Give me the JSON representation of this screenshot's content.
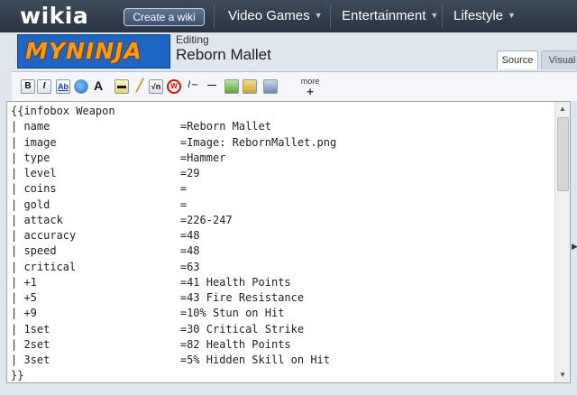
{
  "topnav": {
    "logo": "wikia",
    "create_wiki": "Create a wiki",
    "items": [
      "Video Games",
      "Entertainment",
      "Lifestyle"
    ]
  },
  "header": {
    "wordmark": "MYNINJA",
    "editing_label": "Editing",
    "page_title": "Reborn Mallet",
    "tabs": {
      "source": "Source",
      "visual": "Visual"
    }
  },
  "toolbar": {
    "buttons": [
      "B",
      "I",
      "Ab",
      "link-globe",
      "A",
      "image",
      "brush",
      "sqrt",
      "no-wiki",
      "signature",
      "hr",
      "gallery",
      "table",
      "template"
    ],
    "more_label": "more",
    "more_plus": "+"
  },
  "editor": {
    "content": "{{infobox Weapon\n| name                    =Reborn Mallet\n| image                   =Image: RebornMallet.png\n| type                    =Hammer\n| level                   =29\n| coins                   =\n| gold                    =\n| attack                  =226-247\n| accuracy                =48\n| speed                   =48\n| critical                =63\n| +1                      =41 Health Points\n| +5                      =43 Fire Resistance\n| +9                      =10% Stun on Hit\n| 1set                    =30 Critical Strike\n| 2set                    =82 Health Points\n| 3set                    =5% Hidden Skill on Hit\n}}"
  },
  "colors": {
    "nav_bg": "#2f3a48",
    "wordmark_bg": "#1e66c4",
    "wordmark_text": "#f29a24"
  }
}
